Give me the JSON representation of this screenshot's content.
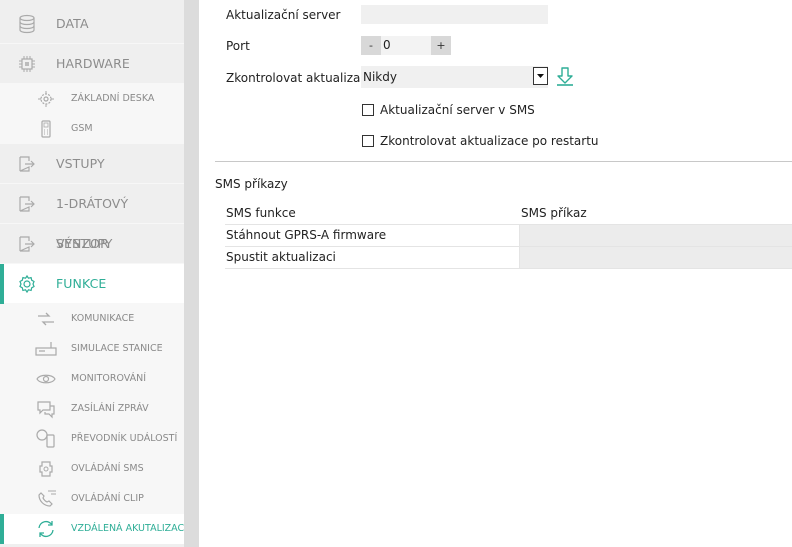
{
  "sidebar": {
    "items": [
      {
        "label": "DATA",
        "icon": "database-icon"
      },
      {
        "label": "HARDWARE",
        "icon": "chip-icon"
      },
      {
        "label": "ZÁKLADNÍ DESKA",
        "icon": "gear-board-icon"
      },
      {
        "label": "GSM",
        "icon": "phone-icon"
      },
      {
        "label": "VSTUPY",
        "icon": "input-icon"
      },
      {
        "label": "1-DRÁTOVÝ SENZOR",
        "icon": "sensor-icon"
      },
      {
        "label": "VÝSTUPY",
        "icon": "output-icon"
      },
      {
        "label": "FUNKCE",
        "icon": "settings-gear-icon"
      },
      {
        "label": "KOMUNIKACE",
        "icon": "arrows-exchange-icon"
      },
      {
        "label": "SIMULACE STANICE",
        "icon": "device-station-icon"
      },
      {
        "label": "MONITOROVÁNÍ",
        "icon": "eye-icon"
      },
      {
        "label": "ZASÍLÁNÍ ZPRÁV",
        "icon": "chat-icon"
      },
      {
        "label": "PŘEVODNÍK UDÁLOSTÍ",
        "icon": "converter-icon"
      },
      {
        "label": "OVLÁDÁNÍ SMS",
        "icon": "puzzle-icon"
      },
      {
        "label": "OVLÁDÁNÍ CLIP",
        "icon": "phone-call-icon"
      },
      {
        "label": "VZDÁLENÁ AKUTALIZACE",
        "icon": "refresh-icon"
      }
    ],
    "accent_color": "#2fae97"
  },
  "form": {
    "server_label": "Aktualizační server",
    "server_value": "",
    "port_label": "Port",
    "port_minus": "-",
    "port_value": "0",
    "port_plus": "+",
    "check_label": "Zkontrolovat aktualizaci",
    "check_value": "Nikdy",
    "cb_sms_label": "Aktualizační server v SMS",
    "cb_sms_checked": false,
    "cb_restart_label": "Zkontrolovat aktualizace po restartu",
    "cb_restart_checked": false
  },
  "sms": {
    "title": "SMS příkazy",
    "columns": [
      "SMS funkce",
      "SMS příkaz"
    ],
    "rows": [
      {
        "function": "Stáhnout GPRS-A firmware",
        "command": ""
      },
      {
        "function": "Spustit aktualizaci",
        "command": ""
      }
    ]
  }
}
